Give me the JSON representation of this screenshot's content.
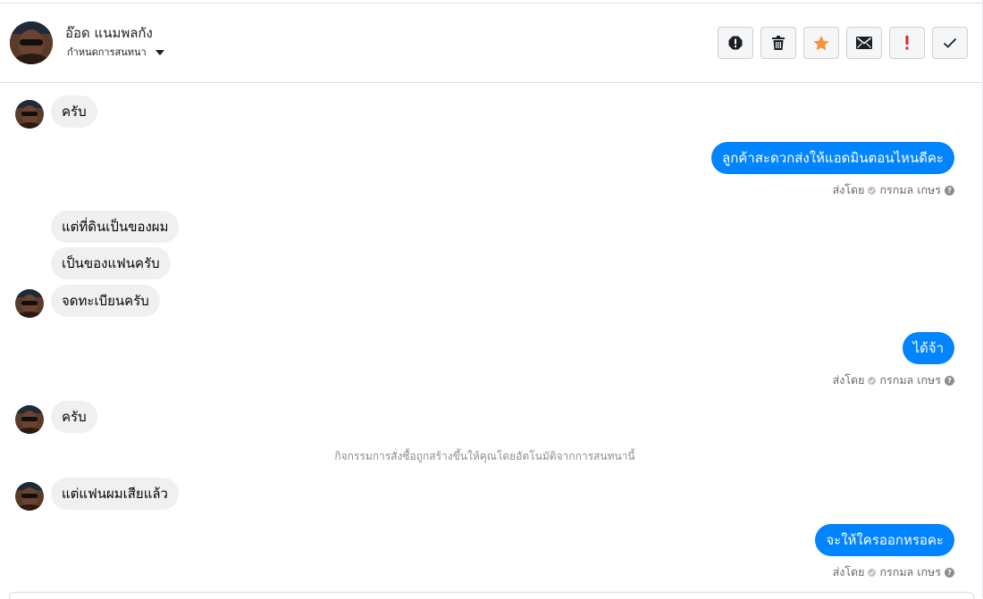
{
  "header": {
    "contact_name": "อ๊อด แนมพลกัง",
    "assign_label": "กำหนดการสนทนา",
    "toolbar": {
      "icons": [
        "alert-circle-icon",
        "trash-icon",
        "star-icon",
        "envelope-icon",
        "exclamation-icon",
        "check-icon"
      ],
      "star_color": "#f7923b",
      "exclamation_color": "#e02424"
    }
  },
  "messages": [
    {
      "side": "in",
      "text": "ครับ"
    },
    {
      "side": "out",
      "text": "ลูกค้าสะดวกส่งให้แอดมินตอนไหนดีคะ",
      "sent_by_prefix": "ส่งโดย",
      "sent_by_name": "กรกมล เกษร"
    },
    {
      "side": "in",
      "text": "แต่ที่ดินเป็นของผม"
    },
    {
      "side": "in",
      "text": "เป็นของแฟนครับ"
    },
    {
      "side": "in",
      "text": "จดทะเบียนครับ"
    },
    {
      "side": "out",
      "text": "ได้จ้า",
      "sent_by_prefix": "ส่งโดย",
      "sent_by_name": "กรกมล เกษร"
    },
    {
      "side": "in",
      "text": "ครับ"
    },
    {
      "side": "system",
      "text": "กิจกรรมการสั่งซื้อถูกสร้างขึ้นให้คุณโดยอัตโนมัติจากการสนทนานี้"
    },
    {
      "side": "in",
      "text": "แต่แฟนผมเสียแล้ว"
    },
    {
      "side": "out",
      "text": "จะให้ใครออกหรอคะ",
      "sent_by_prefix": "ส่งโดย",
      "sent_by_name": "กรกมล เกษร"
    }
  ],
  "colors": {
    "outgoing_bubble": "#0084ff",
    "incoming_bubble": "#f0f0f0"
  }
}
